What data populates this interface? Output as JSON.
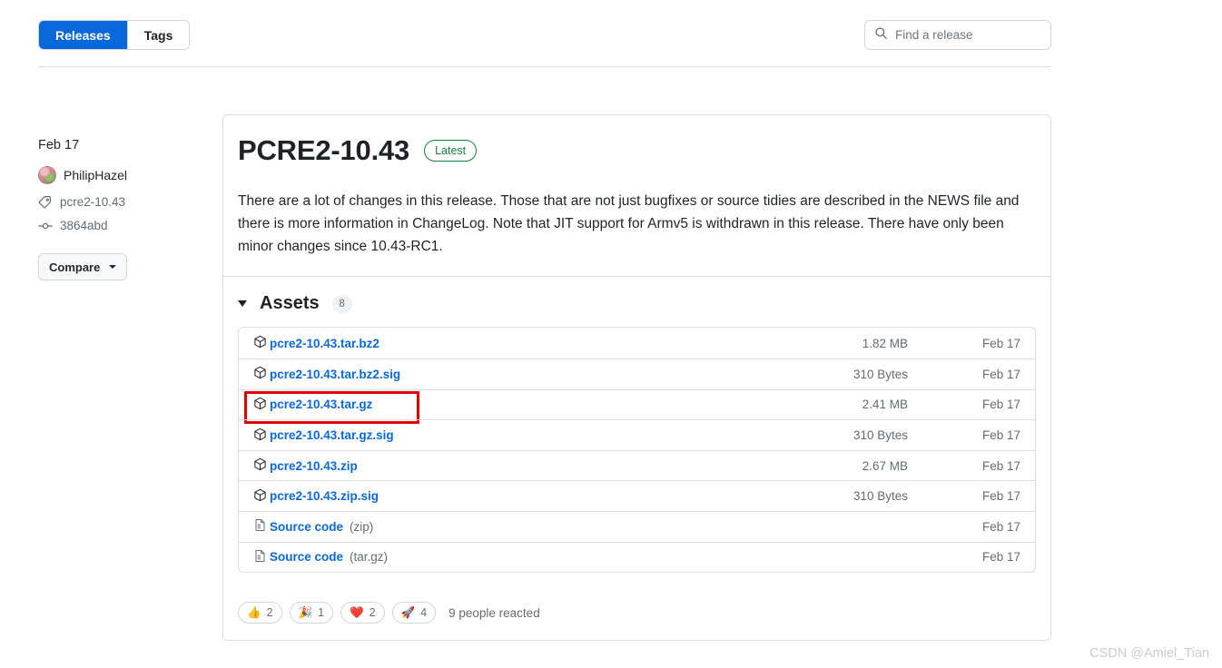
{
  "tabs": {
    "releases_label": "Releases",
    "tags_label": "Tags"
  },
  "search": {
    "placeholder": "Find a release",
    "value": "",
    "icon": "search-icon"
  },
  "sidebar": {
    "date": "Feb 17",
    "author": "PhilipHazel",
    "tag": "pcre2-10.43",
    "commit": "3864abd",
    "compare_label": "Compare"
  },
  "release": {
    "title": "PCRE2-10.43",
    "badge": "Latest",
    "description": "There are a lot of changes in this release. Those that are not just bugfixes or source tidies are described in the NEWS file and there is more information in ChangeLog. Note that JIT support for Armv5 is withdrawn in this release. There have only been minor changes since 10.43-RC1."
  },
  "assets": {
    "title": "Assets",
    "count": "8",
    "rows": [
      {
        "name": "pcre2-10.43.tar.bz2",
        "suffix": "",
        "icon": "package-icon",
        "size": "1.82 MB",
        "date": "Feb 17",
        "highlighted": false
      },
      {
        "name": "pcre2-10.43.tar.bz2.sig",
        "suffix": "",
        "icon": "package-icon",
        "size": "310 Bytes",
        "date": "Feb 17",
        "highlighted": false
      },
      {
        "name": "pcre2-10.43.tar.gz",
        "suffix": "",
        "icon": "package-icon",
        "size": "2.41 MB",
        "date": "Feb 17",
        "highlighted": true
      },
      {
        "name": "pcre2-10.43.tar.gz.sig",
        "suffix": "",
        "icon": "package-icon",
        "size": "310 Bytes",
        "date": "Feb 17",
        "highlighted": false
      },
      {
        "name": "pcre2-10.43.zip",
        "suffix": "",
        "icon": "package-icon",
        "size": "2.67 MB",
        "date": "Feb 17",
        "highlighted": false
      },
      {
        "name": "pcre2-10.43.zip.sig",
        "suffix": "",
        "icon": "package-icon",
        "size": "310 Bytes",
        "date": "Feb 17",
        "highlighted": false
      },
      {
        "name": "Source code",
        "suffix": "(zip)",
        "icon": "file-code-icon",
        "size": "",
        "date": "Feb 17",
        "highlighted": false
      },
      {
        "name": "Source code",
        "suffix": "(tar.gz)",
        "icon": "file-code-icon",
        "size": "",
        "date": "Feb 17",
        "highlighted": false
      }
    ]
  },
  "reactions": {
    "items": [
      {
        "emoji": "👍",
        "count": "2",
        "name": "thumbs-up"
      },
      {
        "emoji": "🎉",
        "count": "1",
        "name": "hooray"
      },
      {
        "emoji": "❤️",
        "count": "2",
        "name": "heart"
      },
      {
        "emoji": "🚀",
        "count": "4",
        "name": "rocket"
      }
    ],
    "summary": "9 people reacted"
  },
  "watermark": "CSDN @Amiel_Tian",
  "colors": {
    "accent": "#0969da",
    "latest_green": "#1a7f37",
    "border": "#d8dee4",
    "muted_text": "#636c76",
    "highlight_red": "#e60000"
  }
}
